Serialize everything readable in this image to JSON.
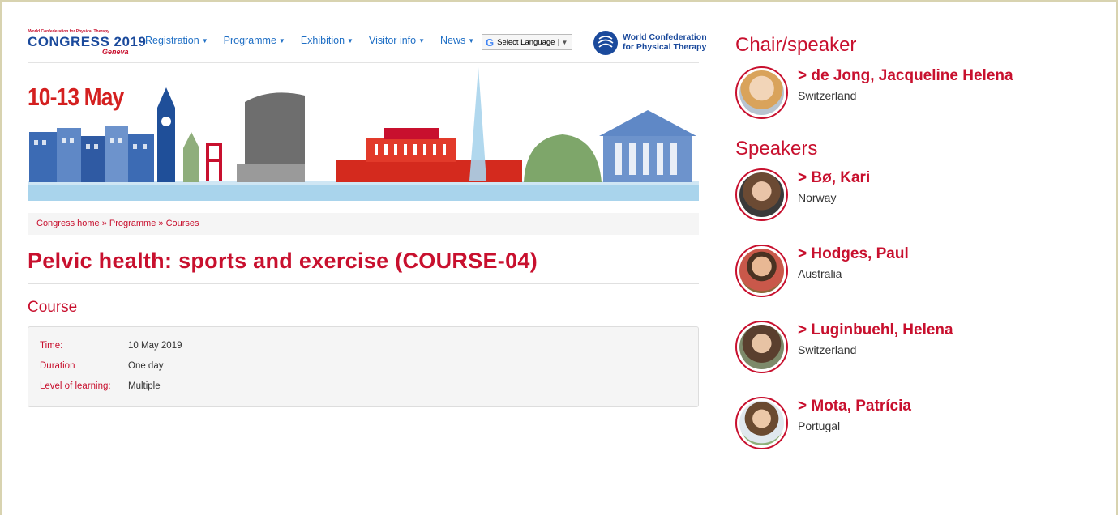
{
  "header": {
    "logo_small": "World Confederation for Physical Therapy",
    "logo_congress": "CONGRESS",
    "logo_year": "2019",
    "logo_city": "Geneva",
    "nav": [
      {
        "label": "Registration"
      },
      {
        "label": "Programme"
      },
      {
        "label": "Exhibition"
      },
      {
        "label": "Visitor info"
      },
      {
        "label": "News"
      }
    ],
    "language_select": "Select Language",
    "org_line1": "World Confederation",
    "org_line2": "for Physical Therapy"
  },
  "banner": {
    "date": "10-13 May"
  },
  "breadcrumb": "Congress home » Programme » Courses",
  "page_title": "Pelvic health: sports and exercise (COURSE-04)",
  "section_title": "Course",
  "details": [
    {
      "label": "Time:",
      "value": "10 May 2019"
    },
    {
      "label": "Duration",
      "value": "One day"
    },
    {
      "label": "Level of learning:",
      "value": "Multiple"
    }
  ],
  "sidebar": {
    "chair_heading": "Chair/speaker",
    "chair": [
      {
        "name": "> de Jong, Jacqueline Helena",
        "country": "Switzerland"
      }
    ],
    "speakers_heading": "Speakers",
    "speakers": [
      {
        "name": "> Bø, Kari",
        "country": "Norway"
      },
      {
        "name": "> Hodges, Paul",
        "country": "Australia"
      },
      {
        "name": "> Luginbuehl, Helena",
        "country": "Switzerland"
      },
      {
        "name": "> Mota, Patrícia",
        "country": "Portugal"
      }
    ]
  },
  "colors": {
    "accent": "#c8102e",
    "link": "#1f6fc5",
    "brand_blue": "#1b4a9c"
  }
}
